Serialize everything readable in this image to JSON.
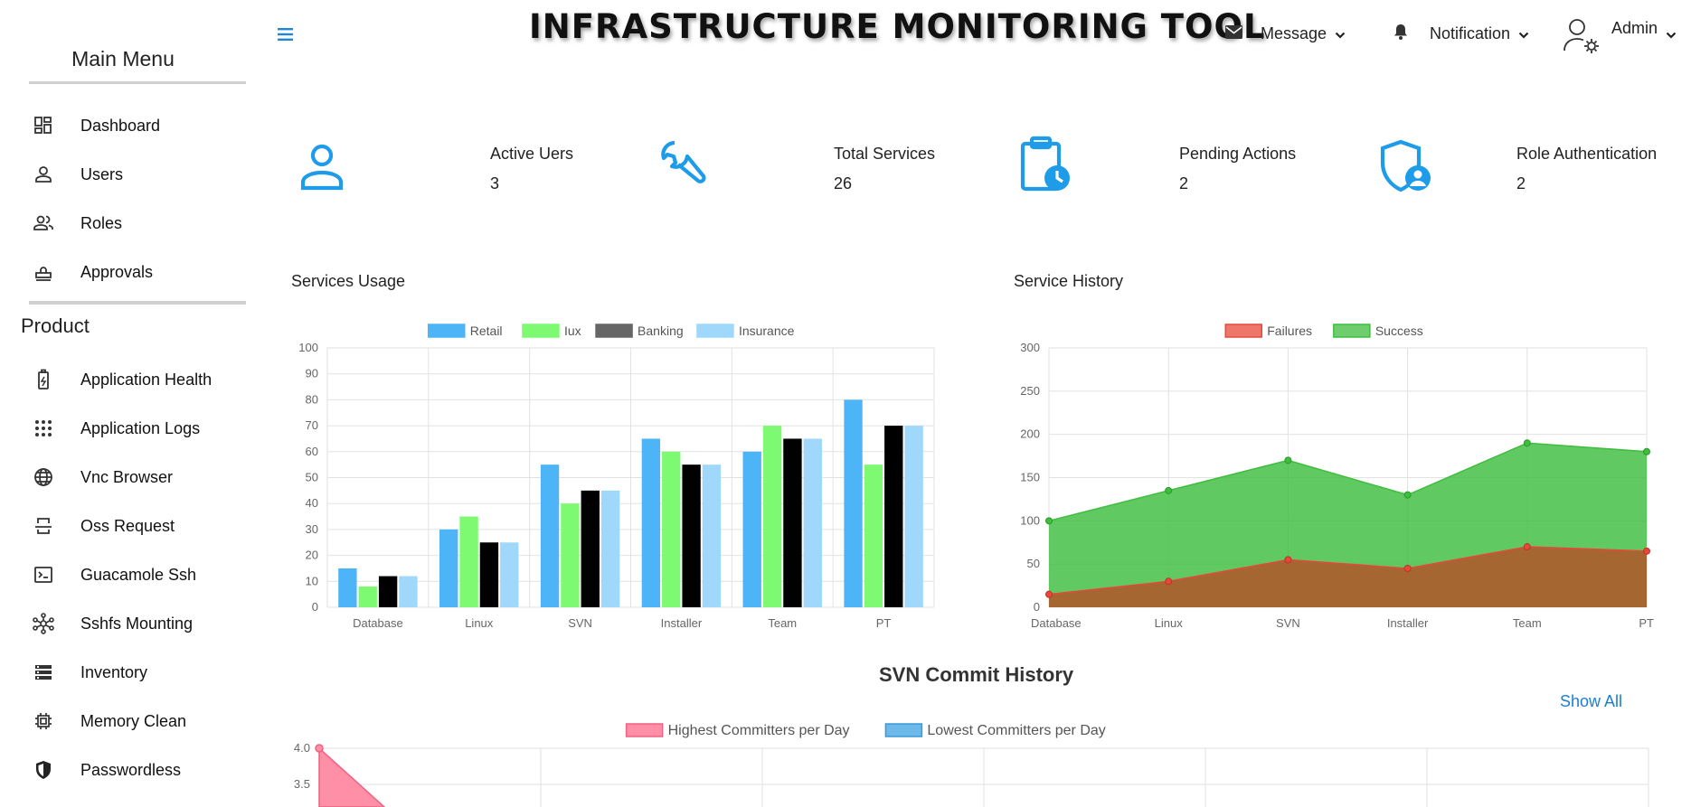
{
  "app": {
    "title": "INFRASTRUCTURE MONITORING TOOL"
  },
  "header": {
    "menu_icon": "hamburger-icon",
    "message": {
      "label": "Message",
      "icon": "envelope-icon"
    },
    "notification": {
      "label": "Notification",
      "icon": "bell-icon"
    },
    "admin": {
      "label": "Admin",
      "icon": "user-gear-icon"
    }
  },
  "sidebar": {
    "menu_title": "Main Menu",
    "main_items": [
      {
        "label": "Dashboard",
        "icon": "dashboard-icon"
      },
      {
        "label": "Users",
        "icon": "user-icon"
      },
      {
        "label": "Roles",
        "icon": "users-icon"
      },
      {
        "label": "Approvals",
        "icon": "stamp-icon"
      }
    ],
    "product_title": "Product",
    "product_items": [
      {
        "label": "Application Health",
        "icon": "battery-charging-icon"
      },
      {
        "label": "Application Logs",
        "icon": "dots-grid-icon"
      },
      {
        "label": "Vnc Browser",
        "icon": "globe-icon"
      },
      {
        "label": "Oss Request",
        "icon": "strikethrough-doc-icon"
      },
      {
        "label": "Guacamole Ssh",
        "icon": "terminal-icon"
      },
      {
        "label": "Sshfs Mounting",
        "icon": "hub-network-icon"
      },
      {
        "label": "Inventory",
        "icon": "storage-icon"
      },
      {
        "label": "Memory Clean",
        "icon": "chip-icon"
      },
      {
        "label": "Passwordless",
        "icon": "shield-icon"
      }
    ]
  },
  "stats": [
    {
      "label": "Active Uers",
      "value": "3",
      "icon": "person-outline-icon"
    },
    {
      "label": "Total Services",
      "value": "26",
      "icon": "wrench-icon"
    },
    {
      "label": "Pending Actions",
      "value": "2",
      "icon": "clipboard-clock-icon"
    },
    {
      "label": "Role Authentication",
      "value": "2",
      "icon": "shield-user-icon"
    }
  ],
  "colors": {
    "accent": "#1e9be9",
    "retail": "#4db4f7",
    "iux": "#7dfa72",
    "banking": "#000000",
    "banking_legend": "#666666",
    "insurance": "#9fd8fa",
    "failures": "#e8483a",
    "success": "#3ebd3e",
    "highest": "#ff8fa6",
    "lowest": "#6cb9ea",
    "link": "#1a7fd0"
  },
  "charts": {
    "services_usage_title": "Services Usage",
    "service_history_title": "Service History",
    "svn_title": "SVN Commit History",
    "show_all": "Show All"
  },
  "chart_data": [
    {
      "type": "bar",
      "title": "Services Usage",
      "categories": [
        "Database",
        "Linux",
        "SVN",
        "Installer",
        "Team",
        "PT"
      ],
      "series": [
        {
          "name": "Retail",
          "values": [
            15,
            30,
            55,
            65,
            60,
            80
          ]
        },
        {
          "name": "Iux",
          "values": [
            8,
            35,
            40,
            60,
            70,
            55
          ]
        },
        {
          "name": "Banking",
          "values": [
            12,
            25,
            45,
            55,
            65,
            70
          ]
        },
        {
          "name": "Insurance",
          "values": [
            12,
            25,
            45,
            55,
            65,
            70
          ]
        }
      ],
      "ylim": [
        0,
        100
      ],
      "yticks": [
        0,
        10,
        20,
        30,
        40,
        50,
        60,
        70,
        80,
        90,
        100
      ],
      "grid": true,
      "legend": "top"
    },
    {
      "type": "area",
      "title": "Service History",
      "categories": [
        "Database",
        "Linux",
        "SVN",
        "Installer",
        "Team",
        "PT"
      ],
      "series": [
        {
          "name": "Failures",
          "values": [
            15,
            30,
            55,
            45,
            70,
            65
          ]
        },
        {
          "name": "Success",
          "values": [
            100,
            135,
            170,
            130,
            190,
            180
          ]
        }
      ],
      "ylim": [
        0,
        300
      ],
      "yticks": [
        0,
        50,
        100,
        150,
        200,
        250,
        300
      ],
      "grid": true,
      "legend": "top"
    },
    {
      "type": "area",
      "title": "SVN Commit History",
      "series": [
        {
          "name": "Highest Committers per Day",
          "values": [
            4.0
          ]
        },
        {
          "name": "Lowest Committers per Day",
          "values": []
        }
      ],
      "yticks": [
        3.5,
        4.0
      ],
      "grid": true,
      "legend": "top"
    }
  ]
}
